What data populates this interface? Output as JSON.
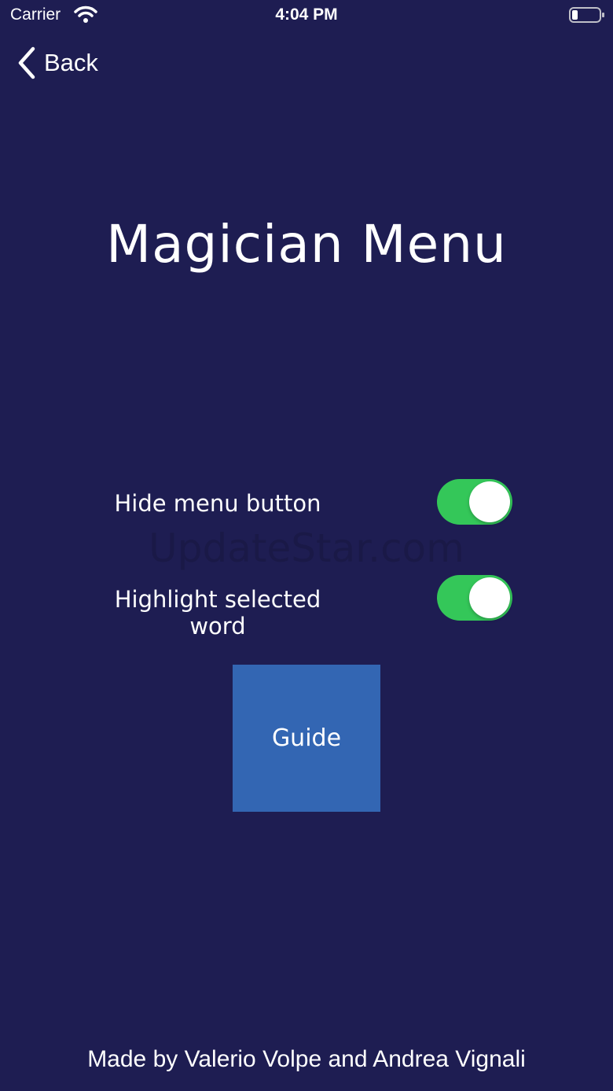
{
  "status_bar": {
    "carrier": "Carrier",
    "time": "4:04 PM",
    "wifi_icon": "wifi-icon",
    "battery_icon": "battery-icon"
  },
  "nav": {
    "back_label": "Back",
    "back_icon": "chevron-left-icon"
  },
  "title": "Magician Menu",
  "settings": [
    {
      "label": "Hide menu button",
      "enabled": true
    },
    {
      "label": "Highlight selected word",
      "enabled": true
    }
  ],
  "watermark": "UpdateStar.com",
  "guide_button": {
    "label": "Guide"
  },
  "credits": "Made by Valerio Volpe and Andrea Vignali",
  "colors": {
    "background": "#1e1d52",
    "toggle_on": "#34c759",
    "guide_button": "#3366b3",
    "text": "#ffffff"
  }
}
